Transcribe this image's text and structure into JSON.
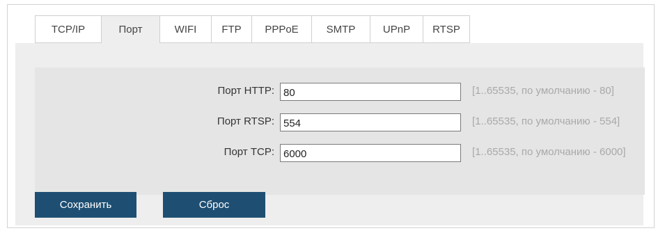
{
  "tabs": [
    {
      "label": "TCP/IP"
    },
    {
      "label": "Порт"
    },
    {
      "label": "WIFI"
    },
    {
      "label": "FTP"
    },
    {
      "label": "PPPoE"
    },
    {
      "label": "SMTP"
    },
    {
      "label": "UPnP"
    },
    {
      "label": "RTSP"
    }
  ],
  "active_tab": "Порт",
  "form": {
    "http": {
      "label": "Порт HTTP:",
      "value": "80",
      "hint": "[1..65535, по умолчанию - 80]"
    },
    "rtsp": {
      "label": "Порт RTSP:",
      "value": "554",
      "hint": "[1..65535, по умолчанию - 554]"
    },
    "tcp": {
      "label": "Порт TCP:",
      "value": "6000",
      "hint": "[1..65535, по умолчанию - 6000]"
    }
  },
  "buttons": {
    "save": "Сохранить",
    "reset": "Сброс"
  },
  "colors": {
    "button_bg": "#1e4f73",
    "panel_bg": "#e5e5e5",
    "hint_text": "#a9a9a9"
  }
}
